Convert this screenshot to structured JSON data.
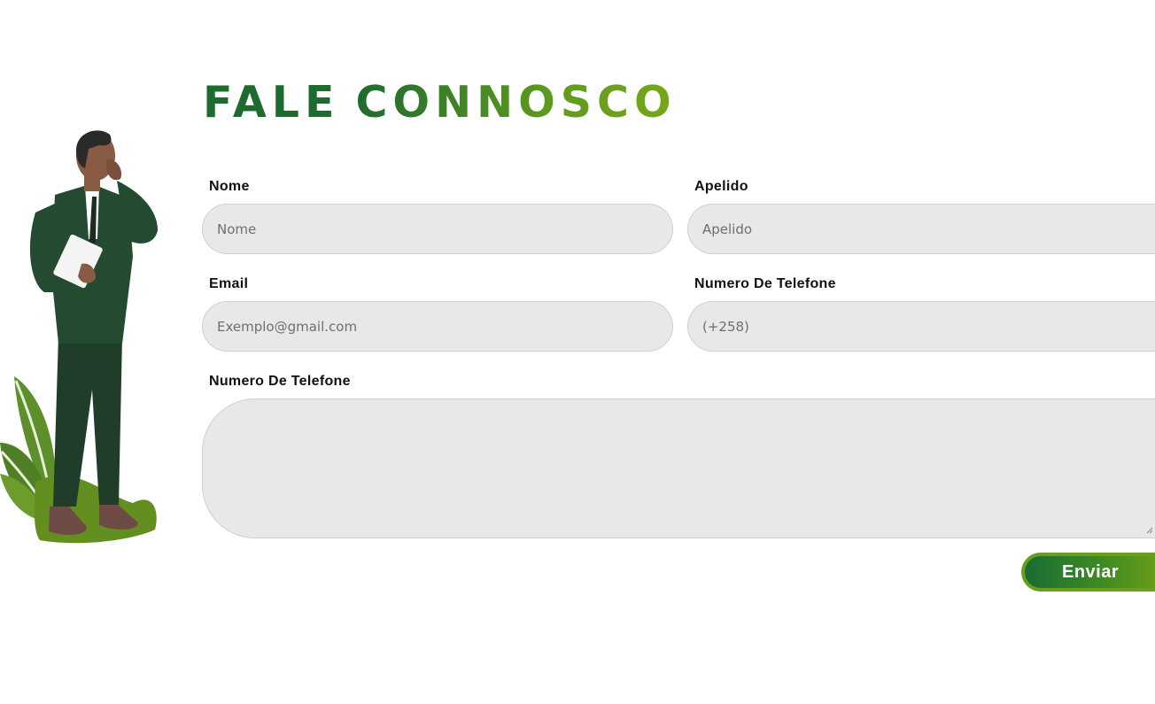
{
  "page": {
    "title_part1": "FALE",
    "title_part2": "CONNOSCO"
  },
  "form": {
    "first_name": {
      "label": "Nome",
      "placeholder": "Nome"
    },
    "last_name": {
      "label": "Apelido",
      "placeholder": "Apelido"
    },
    "email": {
      "label": "Email",
      "placeholder": "Exemplo@gmail.com"
    },
    "phone": {
      "label": "Numero De Telefone",
      "placeholder": "(+258)"
    },
    "message": {
      "label": "Numero De Telefone"
    },
    "submit_label": "Enviar"
  },
  "colors": {
    "primary_green": "#1d6b2f",
    "accent_olive": "#77a81a",
    "field_background": "#e8e8e8"
  },
  "illustration": {
    "icon": "businessman-on-phone-with-plants-icon"
  }
}
